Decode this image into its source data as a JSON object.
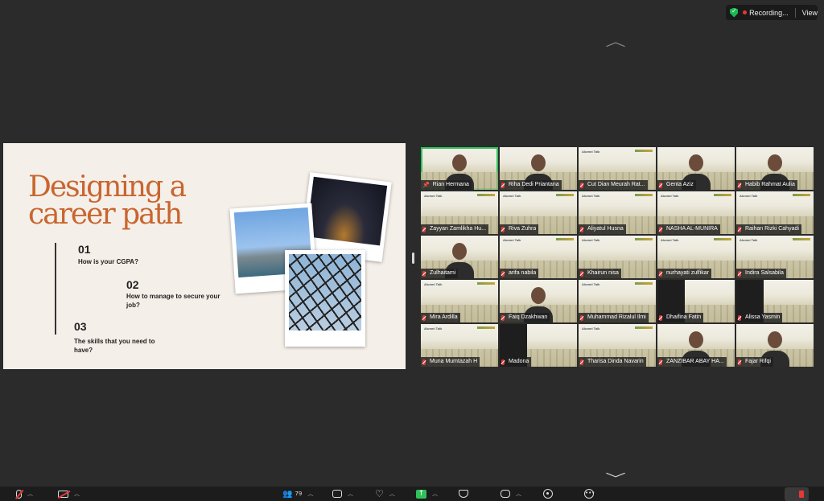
{
  "top_bar": {
    "recording_label": "Recording...",
    "view_label": "View",
    "colors": {
      "shield": "#1db954",
      "record_dot": "#e53935"
    }
  },
  "slide": {
    "title_line1": "Designing a",
    "title_line2": "career path",
    "items": [
      {
        "num": "01",
        "text": "How is your CGPA?"
      },
      {
        "num": "02",
        "text": "How to manage to secure your job?"
      },
      {
        "num": "03",
        "text": "The skills that you need to have?"
      }
    ],
    "accent_color": "#c8662f"
  },
  "gallery": {
    "tiles": [
      {
        "name": "Rian Hermana",
        "type": "video",
        "pinned": true,
        "speaker": true
      },
      {
        "name": "Riha Dedi Priantana",
        "type": "video"
      },
      {
        "name": "Cut Dian Meurah Rat...",
        "type": "slide"
      },
      {
        "name": "Genta Aziz",
        "type": "video"
      },
      {
        "name": "Habib Rahmat Aulia",
        "type": "video"
      },
      {
        "name": "Zayyan Zamlikha Hu...",
        "type": "slide"
      },
      {
        "name": "Riva Zuhra",
        "type": "slide"
      },
      {
        "name": "Aliyatul Husna",
        "type": "slide"
      },
      {
        "name": "NASHA AL-MUNIRA",
        "type": "slide"
      },
      {
        "name": "Raihan Rizki Cahyadi",
        "type": "slide"
      },
      {
        "name": "Zulhaitami",
        "type": "video"
      },
      {
        "name": "arifa nabila",
        "type": "slide"
      },
      {
        "name": "Khairun nisa",
        "type": "slide"
      },
      {
        "name": "nurhayati zulfikar",
        "type": "slide"
      },
      {
        "name": "Indira Salsabila",
        "type": "slide"
      },
      {
        "name": "Mira Ardilla",
        "type": "slide"
      },
      {
        "name": "Faiq Dzakhwan",
        "type": "video"
      },
      {
        "name": "Muhammad Rizalul Ilmi",
        "type": "slide"
      },
      {
        "name": "Dhaifina Fatin",
        "type": "dark"
      },
      {
        "name": "Alissa Yasmin",
        "type": "dark"
      },
      {
        "name": "Muna Mumtazah H",
        "type": "slide"
      },
      {
        "name": "Madona",
        "type": "dark"
      },
      {
        "name": "Tharisa Dinda Navarin",
        "type": "slide"
      },
      {
        "name": "ZANZIBAR ABAY HA...",
        "type": "video"
      },
      {
        "name": "Fajar Rifqi",
        "type": "video"
      }
    ],
    "slide_thumbnail_title": "Alumni Talk"
  },
  "toolbar": {
    "participants_count": "79",
    "items": [
      "mute",
      "video",
      "participants",
      "chat",
      "react",
      "share",
      "security",
      "apps",
      "record",
      "more"
    ]
  }
}
